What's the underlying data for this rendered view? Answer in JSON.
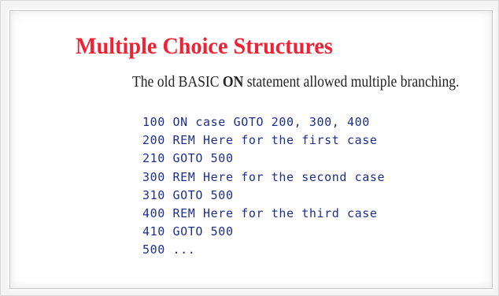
{
  "slide": {
    "title": "Multiple Choice Structures",
    "subtitle": {
      "before": "The old BASIC ",
      "keyword": "ON",
      "after": " statement allowed multiple branching."
    },
    "code_lines": [
      "100 ON case GOTO 200, 300, 400",
      "200 REM Here for the first case",
      "210 GOTO 500",
      "300 REM Here for the second case",
      "310 GOTO 500",
      "400 REM Here for the third case",
      "410 GOTO 500",
      "500 ..."
    ]
  },
  "colors": {
    "title": "#ee2233",
    "code": "#1d2f8c",
    "text": "#222222"
  }
}
